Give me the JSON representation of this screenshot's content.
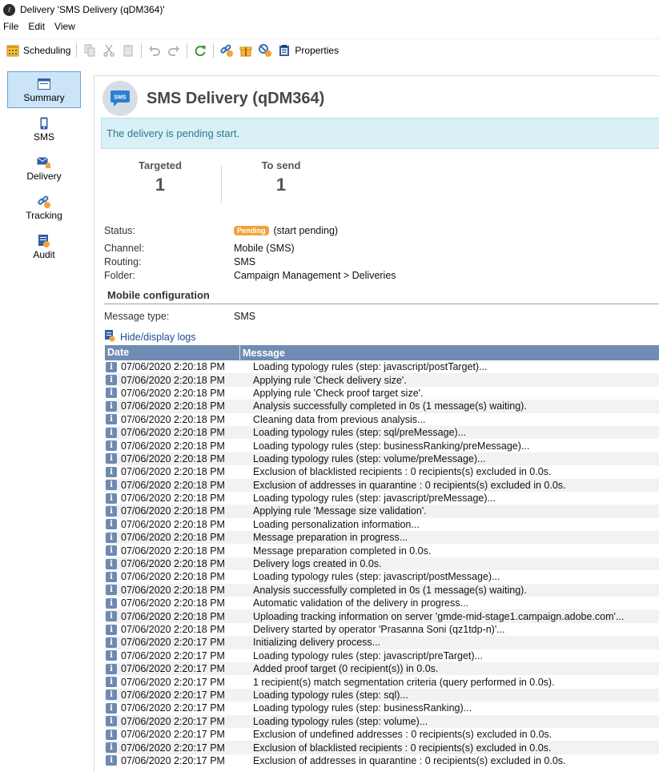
{
  "window": {
    "title": "Delivery 'SMS Delivery (qDM364)'"
  },
  "menu": [
    "File",
    "Edit",
    "View"
  ],
  "toolbar": {
    "scheduling_label": "Scheduling",
    "properties_label": "Properties"
  },
  "nav": [
    {
      "label": "Summary",
      "icon": "summary-icon",
      "active": true
    },
    {
      "label": "SMS",
      "icon": "mobile-icon",
      "active": false
    },
    {
      "label": "Delivery",
      "icon": "delivery-icon",
      "active": false
    },
    {
      "label": "Tracking",
      "icon": "tracking-icon",
      "active": false
    },
    {
      "label": "Audit",
      "icon": "audit-icon",
      "active": false
    }
  ],
  "summary": {
    "title": "SMS Delivery (qDM364)",
    "avatar_text": "SMS",
    "banner": "The delivery is pending start.",
    "targeted_label": "Targeted",
    "targeted_value": "1",
    "tosend_label": "To send",
    "tosend_value": "1",
    "status_label": "Status:",
    "status_badge": "Pending",
    "status_text": "(start pending)",
    "channel_label": "Channel:",
    "channel_value": "Mobile (SMS)",
    "routing_label": "Routing:",
    "routing_value": "SMS",
    "folder_label": "Folder:",
    "folder_value": "Campaign Management > Deliveries",
    "section_title": "Mobile configuration",
    "message_type_label": "Message type:",
    "message_type_value": "SMS",
    "logs_link": "Hide/display logs"
  },
  "logs": {
    "columns": [
      "Date",
      "Message"
    ],
    "rows": [
      [
        "07/06/2020 2:20:18 PM",
        "Loading typology rules (step: javascript/postTarget)..."
      ],
      [
        "07/06/2020 2:20:18 PM",
        "Applying rule 'Check delivery size'."
      ],
      [
        "07/06/2020 2:20:18 PM",
        "Applying rule 'Check proof target size'."
      ],
      [
        "07/06/2020 2:20:18 PM",
        "Analysis successfully completed in 0s (1 message(s) waiting)."
      ],
      [
        "07/06/2020 2:20:18 PM",
        "Cleaning data from previous analysis..."
      ],
      [
        "07/06/2020 2:20:18 PM",
        "Loading typology rules (step: sql/preMessage)..."
      ],
      [
        "07/06/2020 2:20:18 PM",
        "Loading typology rules (step: businessRanking/preMessage)..."
      ],
      [
        "07/06/2020 2:20:18 PM",
        "Loading typology rules (step: volume/preMessage)..."
      ],
      [
        "07/06/2020 2:20:18 PM",
        "Exclusion of blacklisted recipients : 0 recipients(s) excluded in 0.0s."
      ],
      [
        "07/06/2020 2:20:18 PM",
        "Exclusion of addresses in quarantine : 0 recipients(s) excluded in 0.0s."
      ],
      [
        "07/06/2020 2:20:18 PM",
        "Loading typology rules (step: javascript/preMessage)..."
      ],
      [
        "07/06/2020 2:20:18 PM",
        "Applying rule 'Message size validation'."
      ],
      [
        "07/06/2020 2:20:18 PM",
        "Loading personalization information..."
      ],
      [
        "07/06/2020 2:20:18 PM",
        "Message preparation in progress..."
      ],
      [
        "07/06/2020 2:20:18 PM",
        "Message preparation completed in 0.0s."
      ],
      [
        "07/06/2020 2:20:18 PM",
        "Delivery logs created in 0.0s."
      ],
      [
        "07/06/2020 2:20:18 PM",
        "Loading typology rules (step: javascript/postMessage)..."
      ],
      [
        "07/06/2020 2:20:18 PM",
        "Analysis successfully completed in 0s (1 message(s) waiting)."
      ],
      [
        "07/06/2020 2:20:18 PM",
        "Automatic validation of the delivery in progress..."
      ],
      [
        "07/06/2020 2:20:18 PM",
        "Uploading tracking information on server 'gmde-mid-stage1.campaign.adobe.com'..."
      ],
      [
        "07/06/2020 2:20:18 PM",
        "Delivery started by operator 'Prasanna Soni (qz1tdp-n)'..."
      ],
      [
        "07/06/2020 2:20:17 PM",
        "Initializing delivery process..."
      ],
      [
        "07/06/2020 2:20:17 PM",
        "Loading typology rules (step: javascript/preTarget)..."
      ],
      [
        "07/06/2020 2:20:17 PM",
        "Added proof target (0 recipient(s)) in 0.0s."
      ],
      [
        "07/06/2020 2:20:17 PM",
        "1 recipient(s) match segmentation criteria (query performed in 0.0s)."
      ],
      [
        "07/06/2020 2:20:17 PM",
        "Loading typology rules (step: sql)..."
      ],
      [
        "07/06/2020 2:20:17 PM",
        "Loading typology rules (step: businessRanking)..."
      ],
      [
        "07/06/2020 2:20:17 PM",
        "Loading typology rules (step: volume)..."
      ],
      [
        "07/06/2020 2:20:17 PM",
        "Exclusion of undefined addresses : 0 recipients(s) excluded in 0.0s."
      ],
      [
        "07/06/2020 2:20:17 PM",
        "Exclusion of blacklisted recipients : 0 recipients(s) excluded in 0.0s."
      ],
      [
        "07/06/2020 2:20:17 PM",
        "Exclusion of addresses in quarantine : 0 recipients(s) excluded in 0.0s."
      ]
    ]
  },
  "colors": {
    "accent": "#6f8db3",
    "banner_bg": "#d9f0f6",
    "badge": "#f2a23a",
    "nav_active": "#cce4f7"
  }
}
